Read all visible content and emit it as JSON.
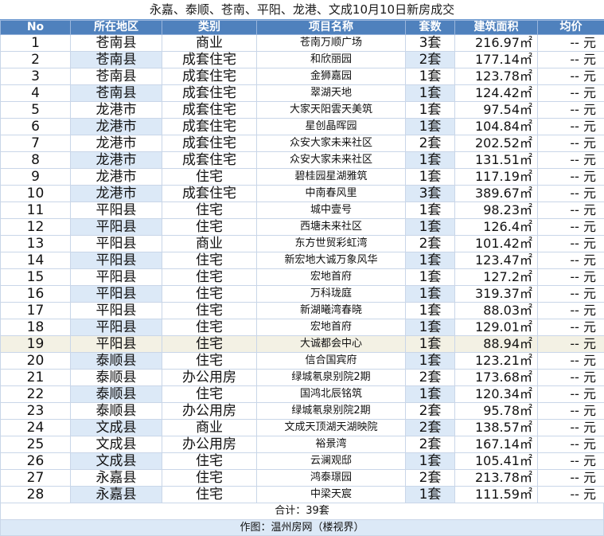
{
  "title": "永嘉、泰顺、苍南、平阳、龙港、文成10月10日新房成交",
  "headers": [
    "No",
    "所在地区",
    "类别",
    "项目名称",
    "套数",
    "建筑面积",
    "均价"
  ],
  "rows": [
    {
      "no": "1",
      "region": "苍南县",
      "category": "商业",
      "project": "苍南万顺广场",
      "units": "3套",
      "area": "216.97㎡",
      "price": "-- 元"
    },
    {
      "no": "2",
      "region": "苍南县",
      "category": "成套住宅",
      "project": "和欣丽园",
      "units": "2套",
      "area": "177.14㎡",
      "price": "-- 元"
    },
    {
      "no": "3",
      "region": "苍南县",
      "category": "成套住宅",
      "project": "金狮嘉园",
      "units": "1套",
      "area": "123.78㎡",
      "price": "-- 元"
    },
    {
      "no": "4",
      "region": "苍南县",
      "category": "成套住宅",
      "project": "翠湖天地",
      "units": "1套",
      "area": "124.42㎡",
      "price": "-- 元"
    },
    {
      "no": "5",
      "region": "龙港市",
      "category": "成套住宅",
      "project": "大家天阳雲天美筑",
      "units": "1套",
      "area": "97.54㎡",
      "price": "-- 元"
    },
    {
      "no": "6",
      "region": "龙港市",
      "category": "成套住宅",
      "project": "星创晶晖园",
      "units": "1套",
      "area": "104.84㎡",
      "price": "-- 元"
    },
    {
      "no": "7",
      "region": "龙港市",
      "category": "成套住宅",
      "project": "众安大家未来社区",
      "units": "2套",
      "area": "202.52㎡",
      "price": "-- 元"
    },
    {
      "no": "8",
      "region": "龙港市",
      "category": "成套住宅",
      "project": "众安大家未来社区",
      "units": "1套",
      "area": "131.51㎡",
      "price": "-- 元"
    },
    {
      "no": "9",
      "region": "龙港市",
      "category": "住宅",
      "project": "碧桂园星湖雅筑",
      "units": "1套",
      "area": "117.19㎡",
      "price": "-- 元"
    },
    {
      "no": "10",
      "region": "龙港市",
      "category": "成套住宅",
      "project": "中南春风里",
      "units": "3套",
      "area": "389.67㎡",
      "price": "-- 元"
    },
    {
      "no": "11",
      "region": "平阳县",
      "category": "住宅",
      "project": "城中壹号",
      "units": "1套",
      "area": "98.23㎡",
      "price": "-- 元"
    },
    {
      "no": "12",
      "region": "平阳县",
      "category": "住宅",
      "project": "西塘未来社区",
      "units": "1套",
      "area": "126.4㎡",
      "price": "-- 元"
    },
    {
      "no": "13",
      "region": "平阳县",
      "category": "商业",
      "project": "东方世贸彩虹湾",
      "units": "2套",
      "area": "101.42㎡",
      "price": "-- 元"
    },
    {
      "no": "14",
      "region": "平阳县",
      "category": "住宅",
      "project": "新宏地大诚万象风华",
      "units": "1套",
      "area": "123.47㎡",
      "price": "-- 元"
    },
    {
      "no": "15",
      "region": "平阳县",
      "category": "住宅",
      "project": "宏地首府",
      "units": "1套",
      "area": "127.2㎡",
      "price": "-- 元"
    },
    {
      "no": "16",
      "region": "平阳县",
      "category": "住宅",
      "project": "万科珑庭",
      "units": "1套",
      "area": "319.37㎡",
      "price": "-- 元"
    },
    {
      "no": "17",
      "region": "平阳县",
      "category": "住宅",
      "project": "新湖曦湾春晓",
      "units": "1套",
      "area": "88.03㎡",
      "price": "-- 元"
    },
    {
      "no": "18",
      "region": "平阳县",
      "category": "住宅",
      "project": "宏地首府",
      "units": "1套",
      "area": "129.01㎡",
      "price": "-- 元"
    },
    {
      "no": "19",
      "region": "平阳县",
      "category": "住宅",
      "project": "大诚都会中心",
      "units": "1套",
      "area": "88.94㎡",
      "price": "-- 元"
    },
    {
      "no": "20",
      "region": "泰顺县",
      "category": "住宅",
      "project": "信合国宾府",
      "units": "1套",
      "area": "123.21㎡",
      "price": "-- 元"
    },
    {
      "no": "21",
      "region": "泰顺县",
      "category": "办公用房",
      "project": "绿城氡泉别院2期",
      "units": "2套",
      "area": "173.68㎡",
      "price": "-- 元"
    },
    {
      "no": "22",
      "region": "泰顺县",
      "category": "住宅",
      "project": "国鸿北辰铭筑",
      "units": "1套",
      "area": "120.34㎡",
      "price": "-- 元"
    },
    {
      "no": "23",
      "region": "泰顺县",
      "category": "办公用房",
      "project": "绿城氡泉别院2期",
      "units": "2套",
      "area": "95.78㎡",
      "price": "-- 元"
    },
    {
      "no": "24",
      "region": "文成县",
      "category": "商业",
      "project": "文成天顶湖天湖映院",
      "units": "2套",
      "area": "138.57㎡",
      "price": "-- 元"
    },
    {
      "no": "25",
      "region": "文成县",
      "category": "办公用房",
      "project": "裕景湾",
      "units": "2套",
      "area": "167.14㎡",
      "price": "-- 元"
    },
    {
      "no": "26",
      "region": "文成县",
      "category": "住宅",
      "project": "云澜观邸",
      "units": "1套",
      "area": "105.41㎡",
      "price": "-- 元"
    },
    {
      "no": "27",
      "region": "永嘉县",
      "category": "住宅",
      "project": "鸿泰璟园",
      "units": "2套",
      "area": "213.78㎡",
      "price": "-- 元"
    },
    {
      "no": "28",
      "region": "永嘉县",
      "category": "住宅",
      "project": "中梁天宸",
      "units": "1套",
      "area": "111.59㎡",
      "price": "-- 元"
    }
  ],
  "summary": "合计：39套",
  "footer": "作图：温州房网（楼视界）",
  "colors": {
    "header_bg": "#4f81bd",
    "highlight": "#dce9f7",
    "selected_row": "#f3f1e4"
  }
}
